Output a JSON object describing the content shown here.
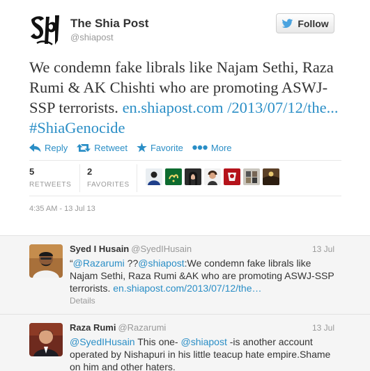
{
  "author": {
    "fullname": "The Shia Post",
    "screenname": "@shiapost",
    "avatar_icon": "shiapost-logo"
  },
  "follow_button": {
    "label": "Follow",
    "icon": "twitter-bird-icon"
  },
  "tweet": {
    "text": "We condemn fake librals like Najam Sethi, Raza Rumi & AK Chishti who are promoting ASWJ-SSP terrorists.",
    "link": "en.shiapost.com /2013/07/12/the...",
    "hashtag": "#ShiaGenocide"
  },
  "actions": {
    "reply": "Reply",
    "retweet": "Retweet",
    "favorite": "Favorite",
    "more": "More"
  },
  "stats": {
    "retweets_count": "5",
    "retweets_label": "RETWEETS",
    "favorites_count": "2",
    "favorites_label": "FAVORITES"
  },
  "timestamp": "4:35 AM - 13 Jul 13",
  "replies": [
    {
      "name": "Syed I Husain",
      "handle": "@SyedIHusain",
      "date": "13 Jul",
      "mention1": "@Razarumi",
      "q": " ??",
      "mention2": "@shiapost",
      "body": ":We condemn fake librals like Najam Sethi, Raza Rumi &AK who are promoting ASWJ-SSP terrorists. ",
      "link": "en.shiapost.com/2013/07/12/the…",
      "details": "Details"
    },
    {
      "name": "Raza Rumi",
      "handle": "@Razarumi",
      "date": "13 Jul",
      "mention1": "@SyedIHusain",
      "body1": " This one- ",
      "mention2": "@shiapost",
      "body2": " -is another account operated by Nishapuri in his little teacup hate empire.Shame on him and other haters."
    }
  ],
  "colors": {
    "link": "#2a8ec6",
    "text": "#333333",
    "muted": "#999999",
    "reply_bg": "#f5f5f5"
  }
}
